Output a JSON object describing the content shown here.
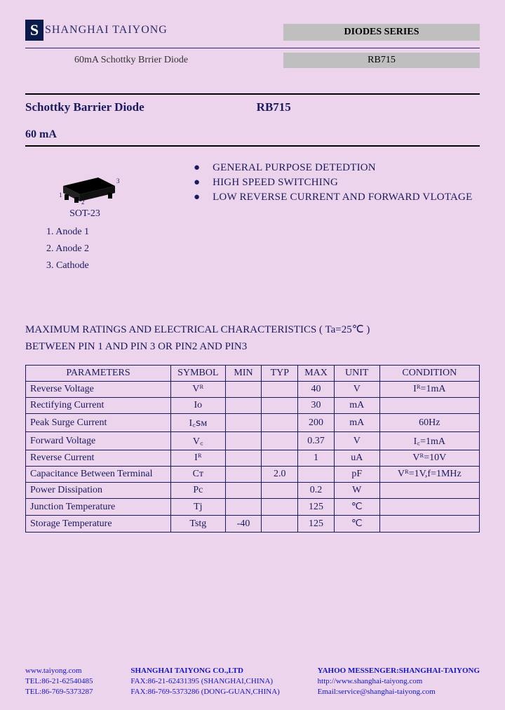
{
  "header": {
    "logo_letter": "S",
    "company": "SHANGHAI TAIYONG",
    "series_label": "DIODES SERIES",
    "sub_desc": "60mA  Schottky Brrier Diode",
    "part_label": "RB715"
  },
  "title": {
    "name": "Schottky Barrier Diode",
    "part": "RB715",
    "current": "60 mA"
  },
  "package": {
    "name": "SOT-23",
    "pins": [
      "1.  Anode 1",
      "2.  Anode 2",
      "3.  Cathode"
    ]
  },
  "features": [
    "GENERAL PURPOSE DETEDTION",
    "HIGH SPEED SWITCHING",
    "LOW REVERSE CURRENT AND FORWARD VLOTAGE"
  ],
  "ratings_title": "MAXIMUM RATINGS AND ELECTRICAL CHARACTERISTICS ( Ta=25℃ )",
  "ratings_subtitle": "BETWEEN PIN 1 AND PIN 3 OR PIN2 AND PIN3",
  "table": {
    "headers": [
      "PARAMETERS",
      "SYMBOL",
      "MIN",
      "TYP",
      "MAX",
      "UNIT",
      "CONDITION"
    ],
    "rows": [
      {
        "param": "Reverse Voltage",
        "symbol": "Vᴿ",
        "min": "",
        "typ": "",
        "max": "40",
        "unit": "V",
        "cond": "Iᴿ=1mA"
      },
      {
        "param": "Rectifying Current",
        "symbol": "Io",
        "min": "",
        "typ": "",
        "max": "30",
        "unit": "mA",
        "cond": ""
      },
      {
        "param": "Peak Surge Current",
        "symbol": "I꜀ꜱᴍ",
        "min": "",
        "typ": "",
        "max": "200",
        "unit": "mA",
        "cond": "60Hz"
      },
      {
        "param": "Forward Voltage",
        "symbol": "V꜀",
        "min": "",
        "typ": "",
        "max": "0.37",
        "unit": "V",
        "cond": "I꜀=1mA"
      },
      {
        "param": "Reverse Current",
        "symbol": "Iᴿ",
        "min": "",
        "typ": "",
        "max": "1",
        "unit": "uA",
        "cond": "Vᴿ=10V"
      },
      {
        "param": "Capacitance Between Terminal",
        "symbol": "Cᴛ",
        "min": "",
        "typ": "2.0",
        "max": "",
        "unit": "pF",
        "cond": "Vᴿ=1V,f=1MHz"
      },
      {
        "param": "Power Dissipation",
        "symbol": "Pc",
        "min": "",
        "typ": "",
        "max": "0.2",
        "unit": "W",
        "cond": ""
      },
      {
        "param": "Junction Temperature",
        "symbol": "Tj",
        "min": "",
        "typ": "",
        "max": "125",
        "unit": "℃",
        "cond": ""
      },
      {
        "param": "Storage Temperature",
        "symbol": "Tstg",
        "min": "-40",
        "typ": "",
        "max": "125",
        "unit": "℃",
        "cond": ""
      }
    ]
  },
  "footer": {
    "col1": [
      "www.taiyong.com",
      "TEL:86-21-62540485",
      "TEL:86-769-5373287"
    ],
    "col2_title": "SHANGHAI TAIYONG CO.,LTD",
    "col2": [
      "FAX:86-21-62431395 (SHANGHAI,CHINA)",
      "FAX:86-769-5373286 (DONG-GUAN,CHINA)"
    ],
    "col3_title": "YAHOO MESSENGER:SHANGHAI-TAIYONG",
    "col3": [
      "http://www.shanghai-taiyong.com",
      "Email:service@shanghai-taiyong.com"
    ]
  }
}
